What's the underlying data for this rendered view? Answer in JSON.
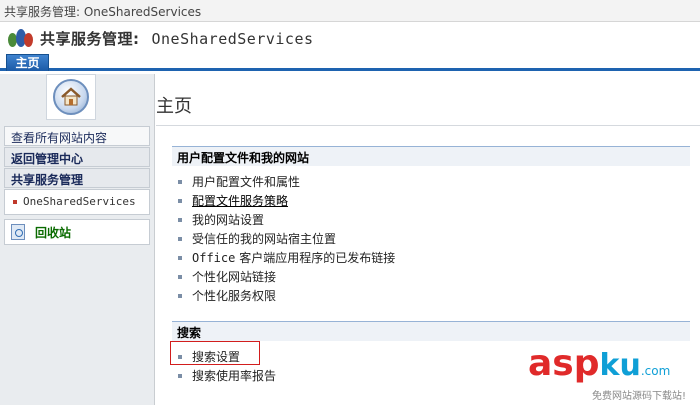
{
  "topbar": {
    "text": "共享服务管理: OneSharedServices"
  },
  "header": {
    "title_prefix": "共享服务管理:",
    "title_name": "OneSharedServices"
  },
  "tabs": [
    {
      "label": "主页"
    }
  ],
  "sidebar": {
    "items": [
      {
        "label": "查看所有网站内容"
      },
      {
        "label": "返回管理中心"
      },
      {
        "label": "共享服务管理"
      }
    ],
    "sub_item": {
      "label": "OneSharedServices"
    },
    "recycle": {
      "label": "回收站"
    }
  },
  "main": {
    "page_title": "主页",
    "sections": [
      {
        "header": "用户配置文件和我的网站",
        "links": [
          "用户配置文件和属性",
          "配置文件服务策略",
          "我的网站设置",
          "受信任的我的网站宿主位置",
          "客户端应用程序的已发布链接",
          "个性化网站链接",
          "个性化服务权限"
        ],
        "office_prefix": "Office"
      },
      {
        "header": "搜索",
        "links": [
          "搜索设置",
          "搜索使用率报告"
        ]
      }
    ]
  },
  "watermark": {
    "asp": "asp",
    "ku": "ku",
    "com": ".com",
    "sub": "免费网站源码下载站!"
  },
  "colors": {
    "accent": "#1e63b0",
    "highlight": "#d21d1d",
    "recycle": "#0a6b00"
  }
}
